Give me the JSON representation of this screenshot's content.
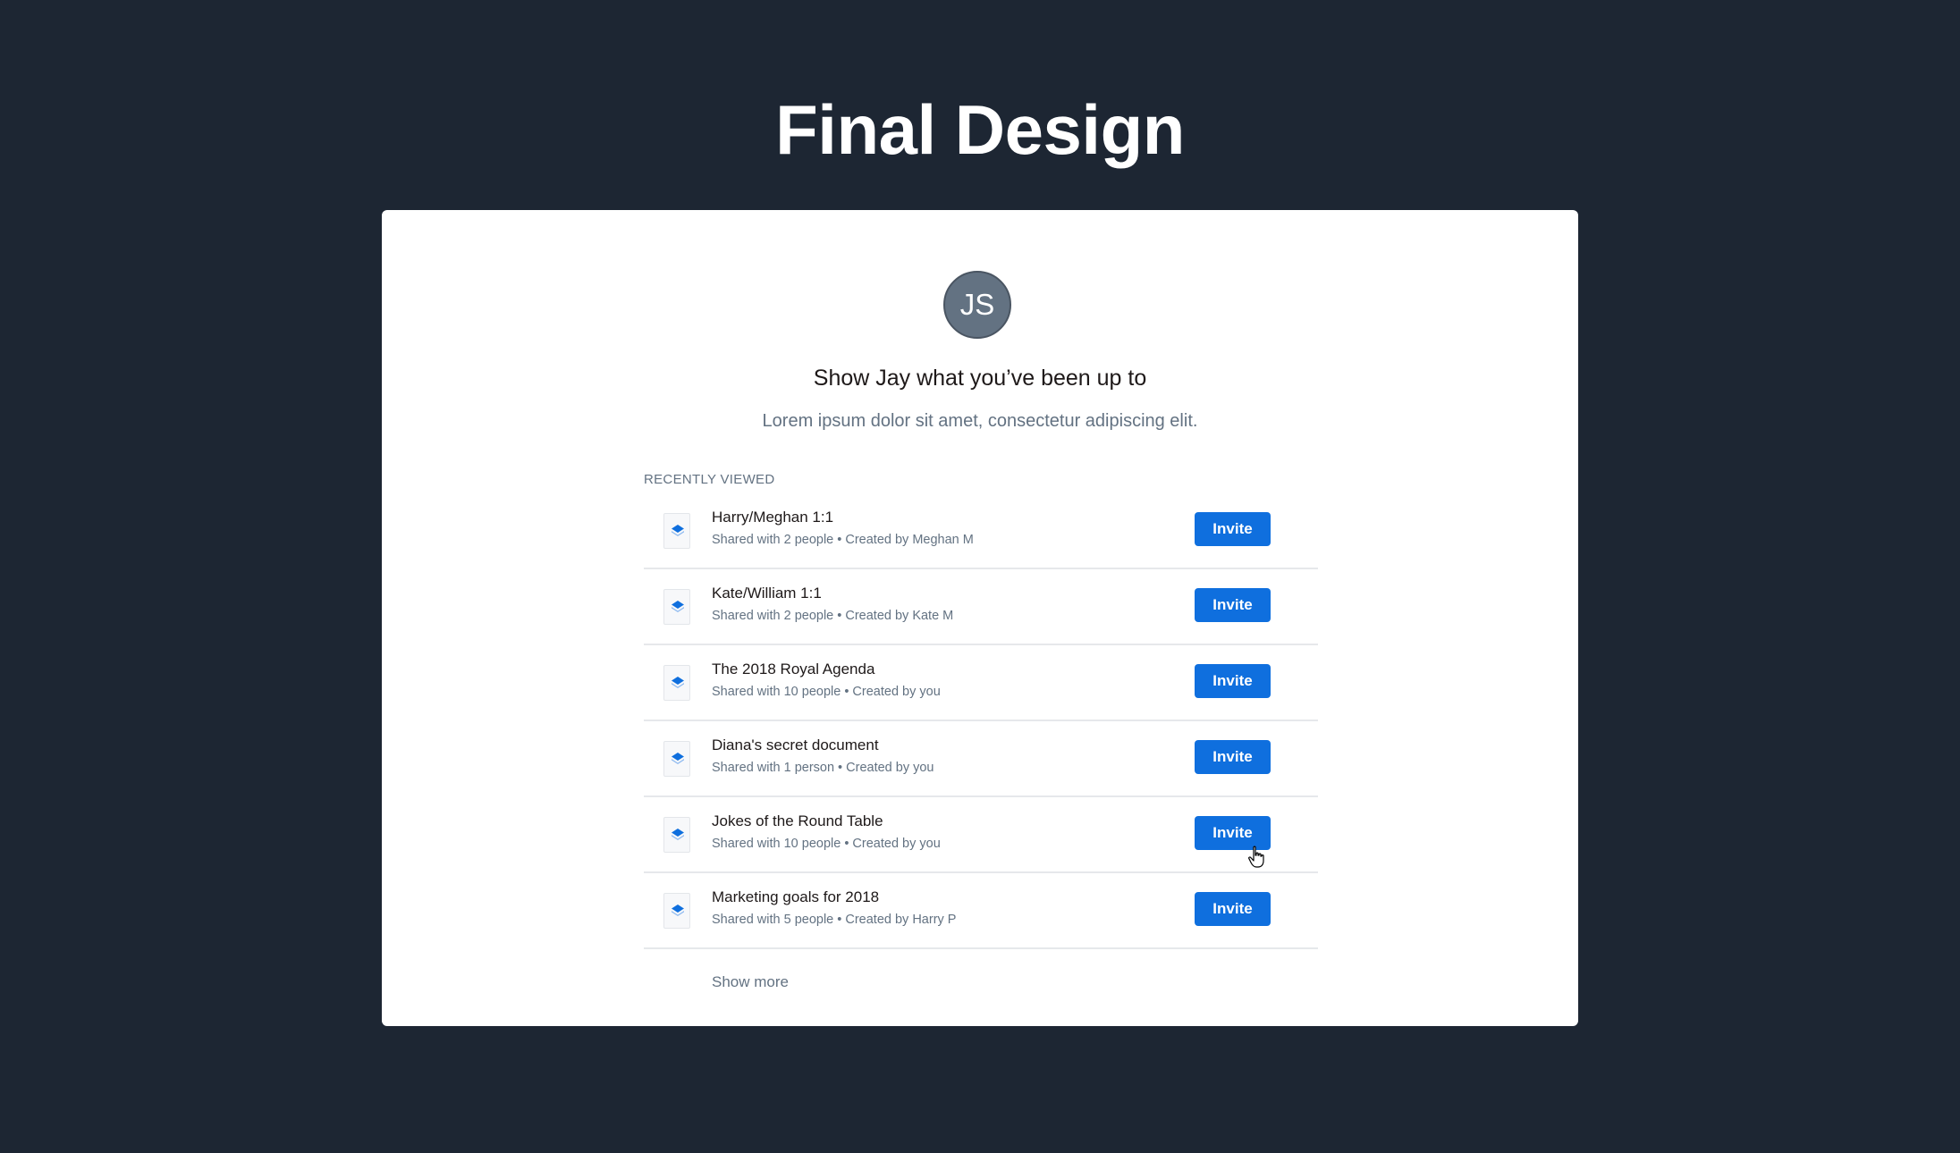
{
  "page": {
    "title": "Final Design"
  },
  "card": {
    "avatar_initials": "JS",
    "heading": "Show Jay what you’ve been up to",
    "subheading": "Lorem ipsum dolor sit amet, consectetur adipiscing elit.",
    "section_label": "RECENTLY VIEWED",
    "items": [
      {
        "title": "Harry/Meghan 1:1",
        "meta": "Shared with 2 people • Created by Meghan M",
        "action": "Invite"
      },
      {
        "title": "Kate/William 1:1",
        "meta": "Shared with 2 people • Created by Kate M",
        "action": "Invite"
      },
      {
        "title": "The 2018 Royal Agenda",
        "meta": "Shared with 10 people • Created by you",
        "action": "Invite"
      },
      {
        "title": "Diana's secret document",
        "meta": "Shared with 1 person • Created by you",
        "action": "Invite"
      },
      {
        "title": "Jokes of the Round Table",
        "meta": "Shared with 10 people • Created by you",
        "action": "Invite"
      },
      {
        "title": "Marketing goals for 2018",
        "meta": "Shared with 5 people • Created by Harry P",
        "action": "Invite"
      }
    ],
    "show_more_label": "Show more",
    "item_icon": "paper-doc-icon"
  },
  "colors": {
    "background": "#1d2633",
    "accent": "#0f6fde",
    "avatar": "#637282"
  }
}
